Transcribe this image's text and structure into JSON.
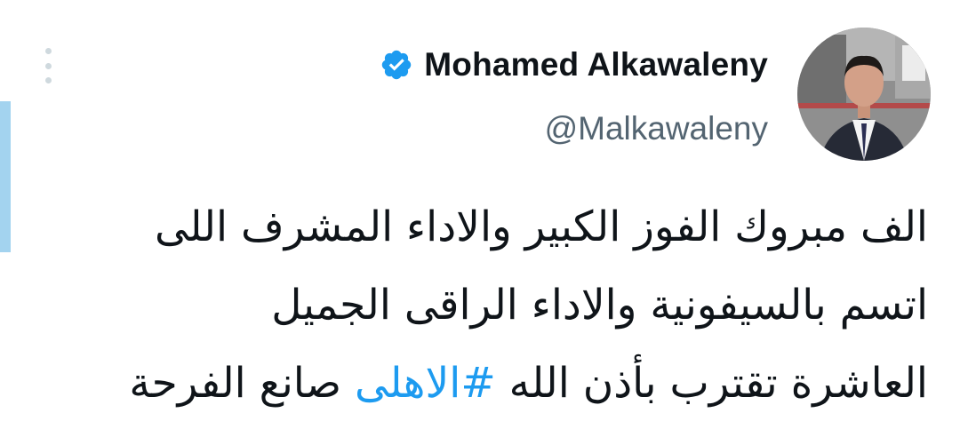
{
  "tweet": {
    "author": {
      "display_name": "Mohamed Alkawaleny",
      "handle": "@Malkawaleny",
      "verified": true,
      "avatar_icon": "profile-photo"
    },
    "text_lines": [
      "الف مبروك الفوز الكبير والاداء المشرف اللى",
      "اتسم بالسيفونية والاداء الراقى الجميل",
      {
        "before": "العاشرة تقترب بأذن الله ",
        "hashtag": "#الاهلى",
        "after": " صانع الفرحة"
      }
    ],
    "more_icon": "more-vertical-icon"
  },
  "colors": {
    "text": "#0f1419",
    "secondary_text": "#536471",
    "link": "#1d9bf0",
    "verified_badge": "#1d9bf0",
    "accent_bar": "#a3d3ef"
  }
}
